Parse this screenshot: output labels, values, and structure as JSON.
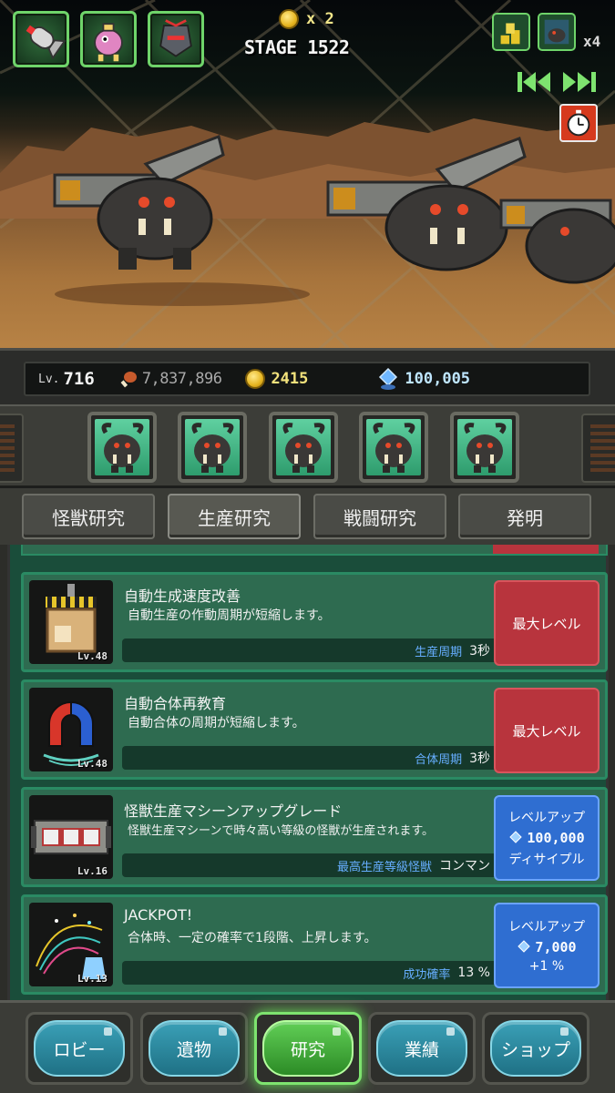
{
  "hud": {
    "coin_multiplier": "x 2",
    "stage": "STAGE 1522",
    "speed": "x4",
    "portraits": [
      "bomb-icon",
      "robot-chicken-icon",
      "skull-knight-icon"
    ],
    "right_icons": [
      "gold-stack-icon",
      "monster-card-icon"
    ]
  },
  "stats": {
    "lv_label": "Lv.",
    "lv_value": "716",
    "meat": "7,837,896",
    "gold": "2415",
    "gems": "100,005"
  },
  "slots": [
    "beast-monster-slot",
    "beast-monster-slot",
    "beast-monster-slot",
    "beast-monster-slot",
    "beast-monster-slot"
  ],
  "tabs": [
    {
      "label": "怪獣研究"
    },
    {
      "label": "生産研究"
    },
    {
      "label": "戦闘研究"
    },
    {
      "label": "発明"
    }
  ],
  "research": [
    {
      "title": "自動生成速度改善",
      "desc": "自動生産の作動周期が短縮します。",
      "lv": "Lv.48",
      "stat_key": "生産周期",
      "stat_value": "3秒",
      "button": {
        "type": "max",
        "label": "最大レベル"
      },
      "icon": "production-machine-icon"
    },
    {
      "title": "自動合体再教育",
      "desc": "自動合体の周期が短縮します。",
      "lv": "Lv.48",
      "stat_key": "合体周期",
      "stat_value": "3秒",
      "button": {
        "type": "max",
        "label": "最大レベル"
      },
      "icon": "magnet-icon"
    },
    {
      "title": "怪獣生産マシーンアップグレード",
      "desc": "怪獣生産マシーンで時々高い等級の怪獣が生産されます。",
      "lv": "Lv.16",
      "stat_key": "最高生産等級怪獣",
      "stat_value": "コンマン",
      "button": {
        "type": "up",
        "label": "レベルアップ",
        "cost": "100,000",
        "sub": "ディサイプル"
      },
      "icon": "machine-upgrade-icon"
    },
    {
      "title": "JACKPOT!",
      "desc": "合体時、一定の確率で1段階、上昇します。",
      "lv": "Lv.13",
      "stat_key": "成功確率",
      "stat_value": "13 %",
      "button": {
        "type": "up",
        "label": "レベルアップ",
        "cost": "7,000",
        "sub": "+1 %"
      },
      "icon": "jackpot-icon"
    }
  ],
  "nav": [
    {
      "label": "ロビー"
    },
    {
      "label": "遺物"
    },
    {
      "label": "研究"
    },
    {
      "label": "業績"
    },
    {
      "label": "ショップ"
    }
  ],
  "colors": {
    "accent_green": "#6fd46a",
    "card_bg": "#2e6b50",
    "max_red": "#b8343d",
    "levelup_blue": "#2f6ed1",
    "stat_key_blue": "#66aeff",
    "gold_text": "#f3e27c"
  }
}
